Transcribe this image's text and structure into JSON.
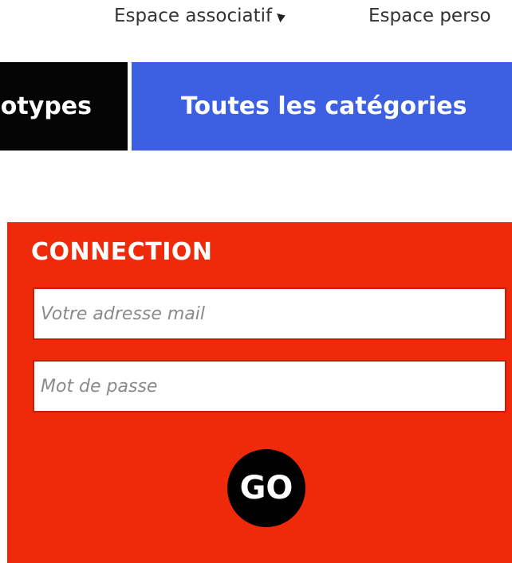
{
  "top_links": {
    "associatif_label": "Espace associatif",
    "associatif_icon": "arrow-icon",
    "perso_label": "Espace perso"
  },
  "tabs": [
    {
      "label": "Stéréotypes",
      "color": "#050505"
    },
    {
      "label": "Toutes les catégories",
      "color": "#3d5fe2"
    }
  ],
  "login": {
    "title": "CONNECTION",
    "panel_color": "#ef2a0a",
    "email_placeholder": "Votre adresse mail",
    "email_value": "",
    "password_placeholder": "Mot de passe",
    "password_value": "",
    "submit_label": "GO"
  }
}
